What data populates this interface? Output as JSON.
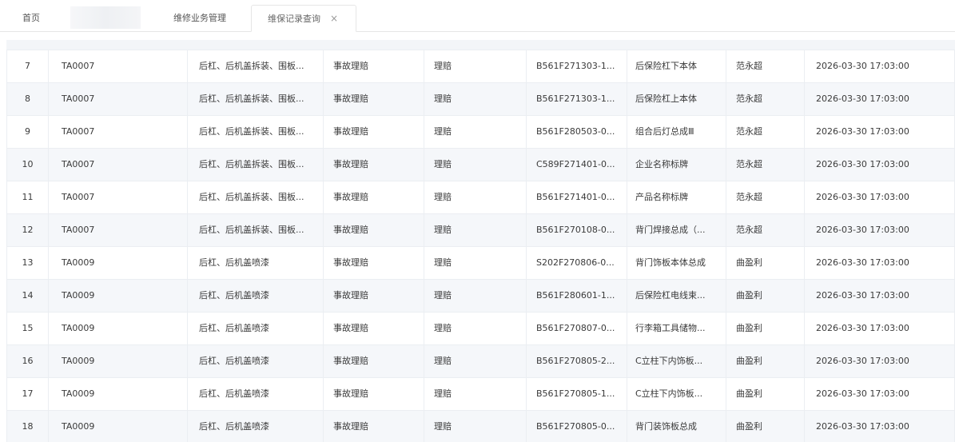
{
  "tabs": {
    "home": "首页",
    "repair_mgmt": "维修业务管理",
    "active": "维保记录查询",
    "close_icon": "×"
  },
  "rows": [
    {
      "no": "7",
      "code": "TA0007",
      "project": "后杠、后机盖拆装、围板...",
      "type": "事故理赔",
      "pay": "理赔",
      "part": "B561F271303-1...",
      "name": "后保险杠下本体",
      "user": "范永超",
      "time": "2026-03-30 17:03:00"
    },
    {
      "no": "8",
      "code": "TA0007",
      "project": "后杠、后机盖拆装、围板...",
      "type": "事故理赔",
      "pay": "理赔",
      "part": "B561F271303-1...",
      "name": "后保险杠上本体",
      "user": "范永超",
      "time": "2026-03-30 17:03:00"
    },
    {
      "no": "9",
      "code": "TA0007",
      "project": "后杠、后机盖拆装、围板...",
      "type": "事故理赔",
      "pay": "理赔",
      "part": "B561F280503-0...",
      "name": "组合后灯总成Ⅲ",
      "user": "范永超",
      "time": "2026-03-30 17:03:00"
    },
    {
      "no": "10",
      "code": "TA0007",
      "project": "后杠、后机盖拆装、围板...",
      "type": "事故理赔",
      "pay": "理赔",
      "part": "C589F271401-0...",
      "name": "企业名称标牌",
      "user": "范永超",
      "time": "2026-03-30 17:03:00"
    },
    {
      "no": "11",
      "code": "TA0007",
      "project": "后杠、后机盖拆装、围板...",
      "type": "事故理赔",
      "pay": "理赔",
      "part": "B561F271401-0...",
      "name": "产品名称标牌",
      "user": "范永超",
      "time": "2026-03-30 17:03:00"
    },
    {
      "no": "12",
      "code": "TA0007",
      "project": "后杠、后机盖拆装、围板...",
      "type": "事故理赔",
      "pay": "理赔",
      "part": "B561F270108-0...",
      "name": "背门焊接总成（...",
      "user": "范永超",
      "time": "2026-03-30 17:03:00"
    },
    {
      "no": "13",
      "code": "TA0009",
      "project": "后杠、后机盖喷漆",
      "type": "事故理赔",
      "pay": "理赔",
      "part": "S202F270806-0...",
      "name": "背门饰板本体总成",
      "user": "曲盈利",
      "time": "2026-03-30 17:03:00"
    },
    {
      "no": "14",
      "code": "TA0009",
      "project": "后杠、后机盖喷漆",
      "type": "事故理赔",
      "pay": "理赔",
      "part": "B561F280601-1...",
      "name": "后保险杠电线束...",
      "user": "曲盈利",
      "time": "2026-03-30 17:03:00"
    },
    {
      "no": "15",
      "code": "TA0009",
      "project": "后杠、后机盖喷漆",
      "type": "事故理赔",
      "pay": "理赔",
      "part": "B561F270807-0...",
      "name": "行李箱工具储物...",
      "user": "曲盈利",
      "time": "2026-03-30 17:03:00"
    },
    {
      "no": "16",
      "code": "TA0009",
      "project": "后杠、后机盖喷漆",
      "type": "事故理赔",
      "pay": "理赔",
      "part": "B561F270805-2...",
      "name": "C立柱下内饰板...",
      "user": "曲盈利",
      "time": "2026-03-30 17:03:00"
    },
    {
      "no": "17",
      "code": "TA0009",
      "project": "后杠、后机盖喷漆",
      "type": "事故理赔",
      "pay": "理赔",
      "part": "B561F270805-1...",
      "name": "C立柱下内饰板...",
      "user": "曲盈利",
      "time": "2026-03-30 17:03:00"
    },
    {
      "no": "18",
      "code": "TA0009",
      "project": "后杠、后机盖喷漆",
      "type": "事故理赔",
      "pay": "理赔",
      "part": "B561F270805-0...",
      "name": "背门装饰板总成",
      "user": "曲盈利",
      "time": "2026-03-30 17:03:00"
    }
  ],
  "colors": {
    "row_even": "#f5f7fa",
    "border": "#ebeef2",
    "text": "#3a3a3a"
  }
}
